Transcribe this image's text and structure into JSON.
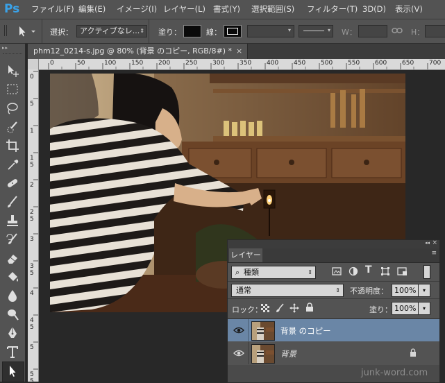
{
  "app": {
    "logo": "Ps"
  },
  "menu": [
    "ファイル(F)",
    "編集(E)",
    "イメージ(I)",
    "レイヤー(L)",
    "書式(Y)",
    "選択範囲(S)",
    "フィルター(T)",
    "3D(D)",
    "表示(V)"
  ],
  "options": {
    "select_label": "選択：",
    "select_value": "アクティブなレ...",
    "fill_label": "塗り：",
    "stroke_label": "線：",
    "w_label": "W：",
    "h_label": "H："
  },
  "document": {
    "tab_title": "phm12_0214-s.jpg @ 80% (背景 のコピー, RGB/8#) *",
    "close": "×"
  },
  "ruler": {
    "top_labels": [
      "0",
      "50",
      "100",
      "150",
      "200",
      "250",
      "300",
      "350",
      "400",
      "450",
      "500",
      "550",
      "600",
      "650",
      "700"
    ],
    "left_labels": [
      "0",
      "5",
      "1",
      "1 5",
      "2",
      "2 5",
      "3",
      "3 5",
      "4",
      "4 5",
      "5",
      "5 5"
    ]
  },
  "layers_panel": {
    "tab": "レイヤー",
    "filter_kind": "種類",
    "blend_mode": "通常",
    "opacity_label": "不透明度：",
    "opacity_value": "100%",
    "lock_label": "ロック：",
    "fill_label": "塗り：",
    "fill_value": "100%",
    "layers": [
      {
        "name": "背景 のコピー",
        "selected": true
      },
      {
        "name": "背景",
        "selected": false,
        "locked": true
      }
    ]
  },
  "watermark": "junk-word.com",
  "colors": {
    "accent": "#6a86a6",
    "ps_blue": "#3aa2e8"
  }
}
